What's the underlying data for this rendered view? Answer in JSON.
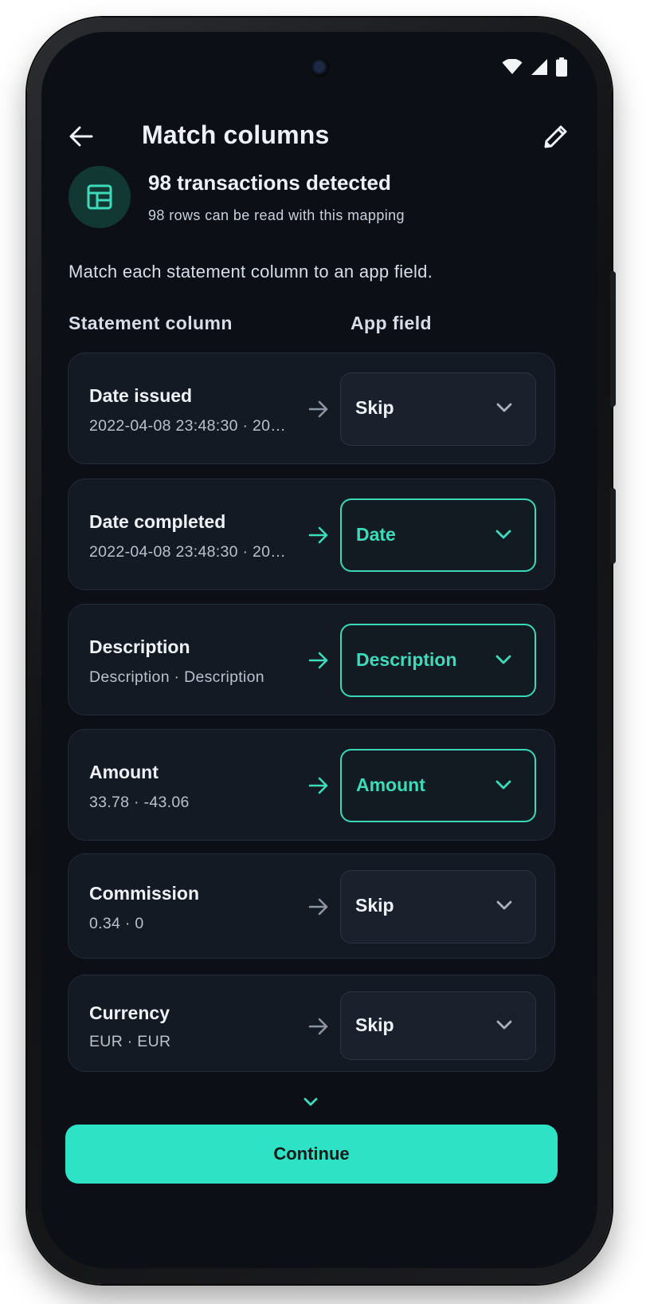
{
  "app_bar": {
    "title": "Match columns",
    "back_icon": "arrow-left-icon",
    "edit_icon": "pencil-icon"
  },
  "status_bar": {
    "icons": [
      "wifi-icon",
      "signal-icon",
      "battery-icon"
    ]
  },
  "summary": {
    "icon": "table-icon",
    "title": "98 transactions detected",
    "subtitle": "98 rows can be read with this mapping"
  },
  "instruction": "Match each statement column to an app field.",
  "headers": {
    "statement_column": "Statement column",
    "app_field": "App field"
  },
  "mappings": [
    {
      "name": "Date issued",
      "sample": "2022-04-08 23:48:30 · 20…",
      "field": "Skip",
      "active": false
    },
    {
      "name": "Date completed",
      "sample": "2022-04-08 23:48:30 · 20…",
      "field": "Date",
      "active": true
    },
    {
      "name": "Description",
      "sample": "Description · Description",
      "field": "Description",
      "active": true
    },
    {
      "name": "Amount",
      "sample": "33.78 · -43.06",
      "field": "Amount",
      "active": true
    },
    {
      "name": "Commission",
      "sample": "0.34 · 0",
      "field": "Skip",
      "active": false
    },
    {
      "name": "Currency",
      "sample": "EUR · EUR",
      "field": "Skip",
      "active": false
    }
  ],
  "continue_label": "Continue",
  "colors": {
    "accent": "#2ee3c5",
    "background": "#0c1016",
    "card": "#141a24"
  }
}
